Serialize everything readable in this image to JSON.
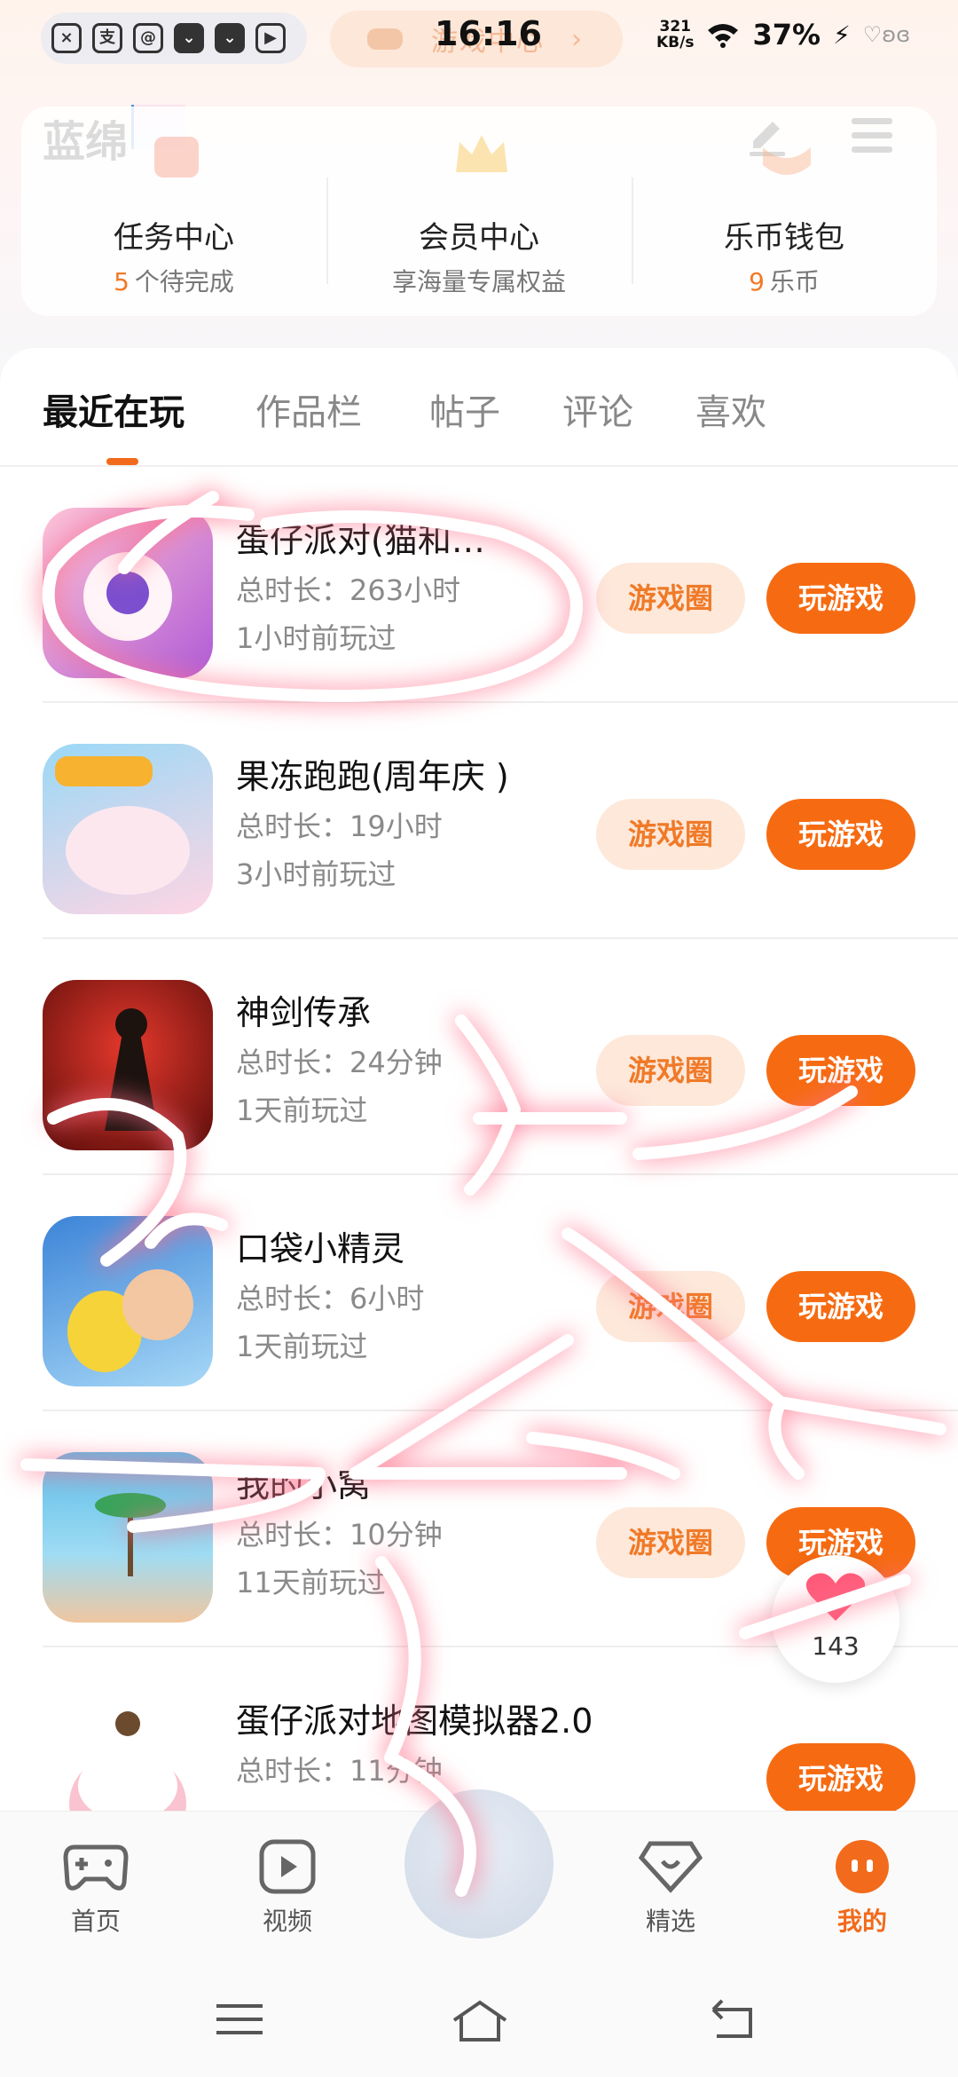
{
  "status_bar": {
    "time": "16:16",
    "net_speed_top": "321",
    "net_speed_unit": "KB/s",
    "battery": "37%",
    "game_center_text": "游戏中心"
  },
  "header": {
    "logo": "蓝绵",
    "edit_icon": "pen-icon",
    "menu_icon": "hamburger-icon"
  },
  "quick_links": [
    {
      "title": "任务中心",
      "num": "5",
      "sub": "个待完成",
      "icon": "calendar-check-icon"
    },
    {
      "title": "会员中心",
      "num": "",
      "sub": "享海量专属权益",
      "icon": "crown-icon"
    },
    {
      "title": "乐币钱包",
      "num": "9",
      "sub": "乐币",
      "icon": "wallet-icon"
    }
  ],
  "tabs": [
    "最近在玩",
    "作品栏",
    "帖子",
    "评论",
    "喜欢"
  ],
  "active_tab": "最近在玩",
  "games": [
    {
      "name": "蛋仔派对(猫和…",
      "duration": "总时长：263小时",
      "last": "1小时前玩过",
      "circle": "游戏圈",
      "play": "玩游戏",
      "icon_colors": [
        "#b05bd6",
        "#ffb0c8"
      ]
    },
    {
      "name": "果冻跑跑(周年庆 )",
      "duration": "总时长：19小时",
      "last": "3小时前玩过",
      "circle": "游戏圈",
      "play": "玩游戏",
      "icon_colors": [
        "#7ec8ef",
        "#ffd7e4"
      ]
    },
    {
      "name": "神剑传承",
      "duration": "总时长：24分钟",
      "last": "1天前玩过",
      "circle": "游戏圈",
      "play": "玩游戏",
      "icon_colors": [
        "#c2201e",
        "#2a1a14"
      ]
    },
    {
      "name": "口袋小精灵",
      "duration": "总时长：6小时",
      "last": "1天前玩过",
      "circle": "游戏圈",
      "play": "玩游戏",
      "icon_colors": [
        "#2f74c8",
        "#f7d33a"
      ]
    },
    {
      "name": "我的小窝",
      "duration": "总时长：10分钟",
      "last": "11天前玩过",
      "circle": "游戏圈",
      "play": "玩游戏",
      "icon_colors": [
        "#52b8e8",
        "#f0c6a0"
      ]
    },
    {
      "name": "蛋仔派对地图模拟器2.0",
      "duration": "总时长：11分钟",
      "last": "",
      "circle": "",
      "play": "玩游戏",
      "icon_colors": [
        "#ffffff",
        "#f6b3c4"
      ]
    }
  ],
  "float_like": {
    "count": "143",
    "icon": "heart-icon"
  },
  "bottom_nav": [
    {
      "label": "首页",
      "icon": "gamepad-icon"
    },
    {
      "label": "视频",
      "icon": "play-square-icon"
    },
    {
      "label": "",
      "icon": "avatar-orb"
    },
    {
      "label": "精选",
      "icon": "heart-gem-icon"
    },
    {
      "label": "我的",
      "icon": "smiley-icon"
    }
  ],
  "colors": {
    "accent": "#f66b12",
    "accent_light": "#fde8da",
    "scribble": "#ff6f8a"
  }
}
